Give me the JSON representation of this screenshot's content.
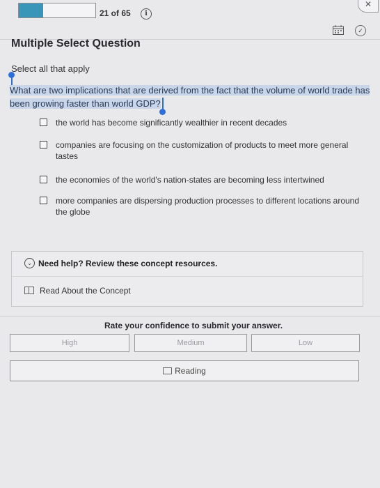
{
  "header": {
    "progress_fraction": 0.32,
    "counter": "21 of 65",
    "info_icon": "info-icon",
    "close_icon": "close-icon",
    "calendar_icon": "calendar-icon",
    "check_icon": "check-circle-icon"
  },
  "question": {
    "type": "Multiple Select Question",
    "instruction": "Select all that apply",
    "prompt": "What are two implications that are derived from the fact that the volume of world trade has been growing faster than world GDP?",
    "options": [
      {
        "label": "the world has become significantly wealthier in recent decades"
      },
      {
        "label": "companies are focusing on the customization of products to meet more general tastes"
      },
      {
        "label": "the economies of the world's nation-states are becoming less intertwined"
      },
      {
        "label": "more companies are dispersing production processes to different locations around the globe"
      }
    ]
  },
  "help": {
    "title": "Need help? Review these concept resources.",
    "link": "Read About the Concept"
  },
  "confidence": {
    "title": "Rate your confidence to submit your answer.",
    "high": "High",
    "medium": "Medium",
    "low": "Low"
  },
  "reading_button": "Reading",
  "colors": {
    "accent": "#3a96b9",
    "selection": "#c9d6ea",
    "handle": "#2d6fd8"
  }
}
